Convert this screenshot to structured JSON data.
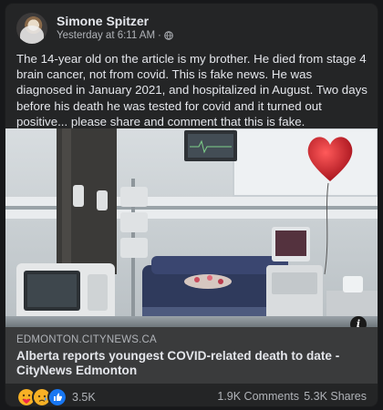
{
  "post": {
    "author": "Simone Spitzer",
    "timestamp": "Yesterday at 6:11 AM",
    "separator": "·",
    "privacy_icon": "globe-icon",
    "caption": "The 14-year old on the article is my brother. He died from stage 4 brain cancer, not from covid. This is fake news. He was diagnosed in January 2021, and hospitalized in August. Two days before his death he was tested for covid and it turned out positive... please share and comment that this is fake."
  },
  "link_preview": {
    "image_icon": "hospital-room-photo",
    "info_label": "i",
    "domain": "EDMONTON.CITYNEWS.CA",
    "title": "Alberta reports youngest COVID-related death to date - CityNews Edmonton"
  },
  "stats": {
    "reactions": [
      "care-reaction-icon",
      "sad-reaction-icon",
      "like-reaction-icon"
    ],
    "reaction_count": "3.5K",
    "comments": "1.9K Comments",
    "shares": "5.3K Shares"
  },
  "colors": {
    "card_bg": "#242526",
    "text_primary": "#e4e6eb",
    "text_secondary": "#b0b3b8",
    "link_bar_bg": "#3a3b3c",
    "balloon_red": "#d21f26",
    "like_blue": "#1877f2"
  }
}
